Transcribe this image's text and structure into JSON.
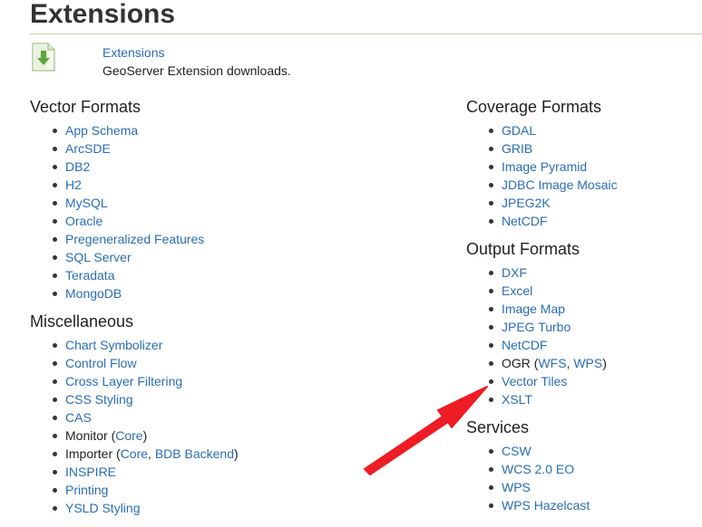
{
  "page": {
    "title": "Extensions"
  },
  "header_entry": {
    "icon": "download-icon",
    "link_label": "Extensions",
    "description": "GeoServer Extension downloads."
  },
  "left_column": [
    {
      "heading": "Vector Formats",
      "items": [
        "App Schema",
        "ArcSDE",
        "DB2",
        "H2",
        "MySQL",
        "Oracle",
        "Pregeneralized Features",
        "SQL Server",
        "Teradata",
        "MongoDB"
      ]
    },
    {
      "heading": "Miscellaneous",
      "items": [
        {
          "label": "Chart Symbolizer"
        },
        {
          "label": "Control Flow"
        },
        {
          "label": "Cross Layer Filtering"
        },
        {
          "label": "CSS Styling"
        },
        {
          "label": "CAS"
        },
        {
          "label": "Monitor",
          "links": [
            "Core"
          ]
        },
        {
          "label": "Importer",
          "links": [
            "Core",
            "BDB Backend"
          ]
        },
        {
          "label": "INSPIRE"
        },
        {
          "label": "Printing"
        },
        {
          "label": "YSLD Styling"
        }
      ]
    }
  ],
  "right_column": [
    {
      "heading": "Coverage Formats",
      "items": [
        "GDAL",
        "GRIB",
        "Image Pyramid",
        "JDBC Image Mosaic",
        "JPEG2K",
        "NetCDF"
      ]
    },
    {
      "heading": "Output Formats",
      "items": [
        {
          "label": "DXF"
        },
        {
          "label": "Excel"
        },
        {
          "label": "Image Map"
        },
        {
          "label": "JPEG Turbo"
        },
        {
          "label": "NetCDF"
        },
        {
          "label": "OGR",
          "links": [
            "WFS",
            "WPS"
          ]
        },
        {
          "label": "Vector Tiles"
        },
        {
          "label": "XSLT"
        }
      ]
    },
    {
      "heading": "Services",
      "items": [
        "CSW",
        "WCS 2.0 EO",
        "WPS",
        "WPS Hazelcast"
      ]
    }
  ],
  "colors": {
    "link": "#2a6db5",
    "text": "#222222",
    "title_rule": "#bcd9a5",
    "icon_green": "#5aa83a",
    "annotation_arrow": "#ee1c24"
  }
}
